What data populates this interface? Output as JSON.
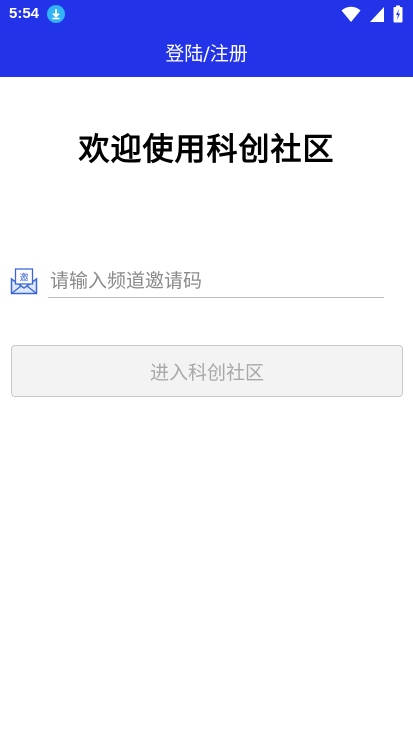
{
  "status_bar": {
    "time": "5:54",
    "icons": [
      "download-icon",
      "wifi-icon",
      "signal-icon",
      "battery-charging-icon"
    ]
  },
  "app_bar": {
    "title": "登陆/注册"
  },
  "welcome": {
    "text": "欢迎使用科创社区"
  },
  "invite": {
    "icon": "invite-envelope-icon",
    "icon_text": "邀",
    "placeholder": "请输入频道邀请码",
    "value": ""
  },
  "enter_button": {
    "label": "进入科创社区"
  },
  "colors": {
    "primary": "#2233e8",
    "download_badge": "#31b4f7",
    "button_bg": "#f3f3f3",
    "button_text": "#a8a8a8"
  }
}
